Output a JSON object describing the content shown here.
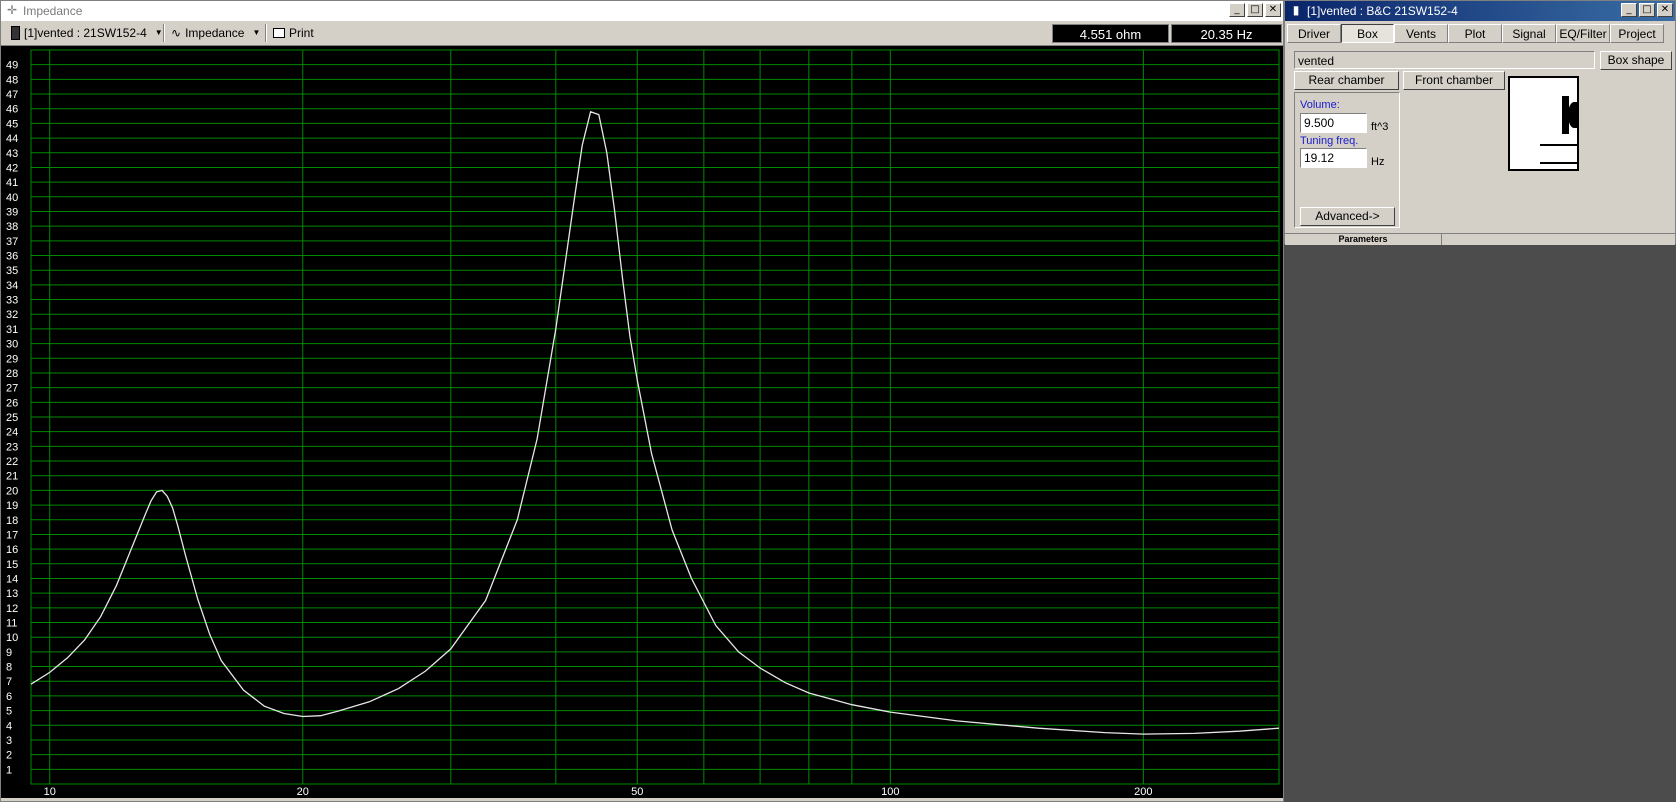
{
  "impedance_window": {
    "title": "Impedance",
    "toolbar": {
      "driver_select": "[1]vented : 21SW152-4",
      "mode_select": "Impedance",
      "print_label": "Print",
      "readout_ohm": "4.551 ohm",
      "readout_hz": "20.35 Hz"
    },
    "colors": {
      "background": "#000000",
      "grid": "#008a00",
      "curve": "#e6e6e6",
      "axis_text": "#ffffff"
    }
  },
  "chart_data": {
    "type": "line",
    "x_scale": "log",
    "xlim": [
      9.5,
      290
    ],
    "ylim": [
      0,
      50
    ],
    "x_tick_labels": [
      10,
      20,
      50,
      100,
      200
    ],
    "y_tick_labels": [
      1,
      2,
      3,
      4,
      5,
      6,
      7,
      8,
      9,
      10,
      11,
      12,
      13,
      14,
      15,
      16,
      17,
      18,
      19,
      20,
      21,
      22,
      23,
      24,
      25,
      26,
      27,
      28,
      29,
      30,
      31,
      32,
      33,
      34,
      35,
      36,
      37,
      38,
      39,
      40,
      41,
      42,
      43,
      44,
      45,
      46,
      47,
      48,
      49
    ],
    "grid": true,
    "series": [
      {
        "x": [
          9.5,
          10,
          10.5,
          11,
          11.5,
          12,
          12.5,
          13,
          13.2,
          13.4,
          13.6,
          13.8,
          14,
          14.2,
          14.5,
          15,
          15.5,
          16,
          17,
          18,
          19,
          20,
          21,
          22,
          24,
          26,
          28,
          30,
          33,
          36,
          38,
          40,
          42,
          43,
          44,
          45,
          46,
          47,
          48,
          49,
          50,
          52,
          55,
          58,
          62,
          66,
          70,
          75,
          80,
          90,
          100,
          120,
          150,
          180,
          200,
          230,
          260,
          290
        ],
        "y": [
          6.8,
          7.6,
          8.6,
          9.8,
          11.4,
          13.5,
          16,
          18.4,
          19.3,
          19.9,
          20,
          19.6,
          18.8,
          17.6,
          15.6,
          12.6,
          10.2,
          8.4,
          6.4,
          5.3,
          4.8,
          4.6,
          4.65,
          4.95,
          5.6,
          6.5,
          7.7,
          9.2,
          12.5,
          18,
          23.5,
          31,
          39.5,
          43.5,
          45.8,
          45.6,
          43,
          39,
          34.5,
          30.5,
          27.5,
          22.5,
          17.3,
          14,
          10.8,
          9,
          7.9,
          6.9,
          6.2,
          5.4,
          4.9,
          4.3,
          3.8,
          3.5,
          3.4,
          3.45,
          3.6,
          3.8
        ]
      }
    ]
  },
  "params_window": {
    "title": "[1]vented : B&C 21SW152-4",
    "tabs": [
      "Driver",
      "Box",
      "Vents",
      "Plot",
      "Signal",
      "EQ/Filter",
      "Project"
    ],
    "selected_tab": "Box",
    "box_type": "vented",
    "box_shape_button": "Box shape",
    "rear_chamber_button": "Rear chamber",
    "front_chamber_button": "Front chamber",
    "volume_label": "Volume:",
    "volume_value": "9.500",
    "volume_unit": "ft^3",
    "tuning_label": "Tuning freq.",
    "tuning_value": "19.12",
    "tuning_unit": "Hz",
    "advanced_button": "Advanced->",
    "status_section": "Parameters"
  }
}
